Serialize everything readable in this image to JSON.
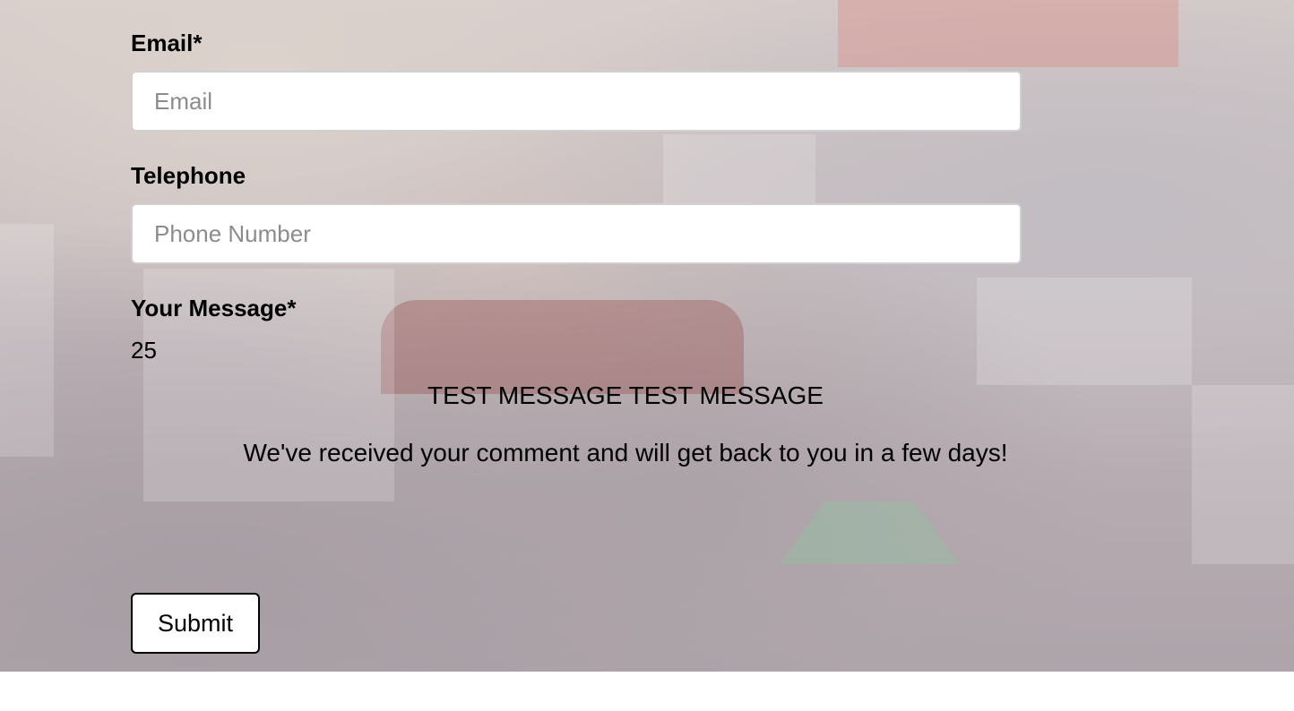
{
  "form": {
    "email": {
      "label": "Email*",
      "placeholder": "Email",
      "value": ""
    },
    "telephone": {
      "label": "Telephone",
      "placeholder": "Phone Number",
      "value": ""
    },
    "message": {
      "label": "Your Message*",
      "char_count": "25"
    },
    "confirmation": {
      "submitted_text": "TEST MESSAGE TEST MESSAGE",
      "thanks_text": "We've received your comment and will get back to you in a few days!"
    },
    "submit_label": "Submit"
  },
  "theme": {
    "input_border": "#d0d0d0",
    "button_border": "#000000",
    "text_color": "#000000",
    "page_background": "#ffffff"
  }
}
